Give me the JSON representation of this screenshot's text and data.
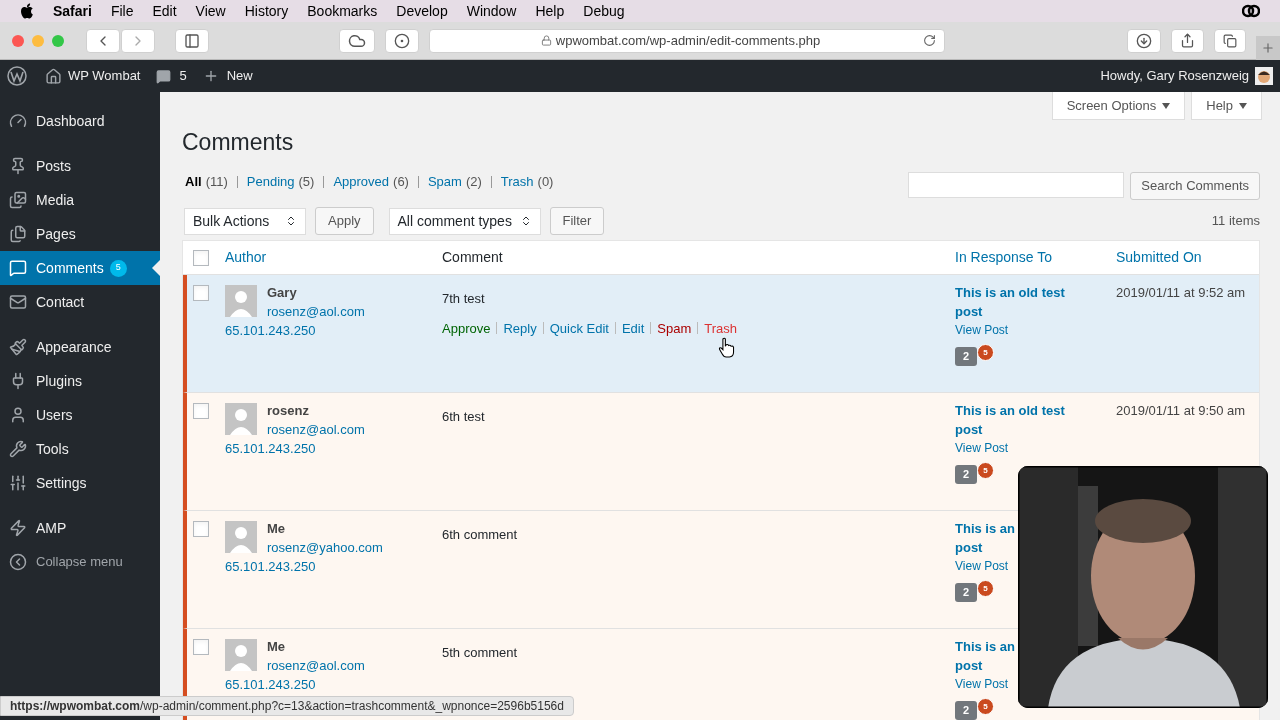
{
  "menubar": {
    "app": "Safari",
    "items": [
      "File",
      "Edit",
      "View",
      "History",
      "Bookmarks",
      "Develop",
      "Window",
      "Help",
      "Debug"
    ]
  },
  "browser": {
    "url": "wpwombat.com/wp-admin/edit-comments.php"
  },
  "adminbar": {
    "site": "WP Wombat",
    "comments": "5",
    "new": "New",
    "howdy": "Howdy, Gary Rosenzweig"
  },
  "sidebar": {
    "items": [
      {
        "label": "Dashboard",
        "selected": false
      },
      {
        "label": "Posts",
        "selected": false
      },
      {
        "label": "Media",
        "selected": false
      },
      {
        "label": "Pages",
        "selected": false
      },
      {
        "label": "Comments",
        "selected": true,
        "badge": "5"
      },
      {
        "label": "Contact",
        "selected": false
      },
      {
        "label": "Appearance",
        "selected": false
      },
      {
        "label": "Plugins",
        "selected": false
      },
      {
        "label": "Users",
        "selected": false
      },
      {
        "label": "Tools",
        "selected": false
      },
      {
        "label": "Settings",
        "selected": false
      },
      {
        "label": "AMP",
        "selected": false
      }
    ],
    "collapse": "Collapse menu"
  },
  "screen_options": "Screen Options",
  "help": "Help",
  "title": "Comments",
  "filters": [
    {
      "label": "All",
      "count": "(11)",
      "selected": true
    },
    {
      "label": "Pending",
      "count": "(5)",
      "selected": false
    },
    {
      "label": "Approved",
      "count": "(6)",
      "selected": false
    },
    {
      "label": "Spam",
      "count": "(2)",
      "selected": false
    },
    {
      "label": "Trash",
      "count": "(0)",
      "selected": false
    }
  ],
  "search_button": "Search Comments",
  "bulk_actions": "Bulk Actions",
  "apply": "Apply",
  "comment_types": "All comment types",
  "filter": "Filter",
  "items_count": "11 items",
  "table": {
    "columns": [
      "Author",
      "Comment",
      "In Response To",
      "Submitted On"
    ],
    "header_checked": false,
    "rows": [
      {
        "checked": false,
        "pending": true,
        "hovered": true,
        "author": "Gary",
        "email": "rosenz@aol.com",
        "ip": "65.101.243.250",
        "comment": "7th test",
        "actions": [
          {
            "label": "Approve",
            "kind": "approve"
          },
          {
            "label": "Reply",
            "kind": "normal"
          },
          {
            "label": "Quick Edit",
            "kind": "normal"
          },
          {
            "label": "Edit",
            "kind": "normal"
          },
          {
            "label": "Spam",
            "kind": "spam"
          },
          {
            "label": "Trash",
            "kind": "trash"
          }
        ],
        "post_title_lines": [
          "This is an old test",
          "post"
        ],
        "view_post": "View Post",
        "approved_count": "2",
        "pending_count": "5",
        "submitted": "2019/01/11 at 9:52 am"
      },
      {
        "checked": false,
        "pending": true,
        "hovered": false,
        "author": "rosenz",
        "email": "rosenz@aol.com",
        "ip": "65.101.243.250",
        "comment": "6th test",
        "post_title_lines": [
          "This is an old test",
          "post"
        ],
        "view_post": "View Post",
        "approved_count": "2",
        "pending_count": "5",
        "submitted": "2019/01/11 at 9:50 am"
      },
      {
        "checked": false,
        "pending": true,
        "hovered": false,
        "author": "Me",
        "email": "rosenz@yahoo.com",
        "ip": "65.101.243.250",
        "comment": "6th comment",
        "post_title_lines": [
          "This is an",
          "post"
        ],
        "view_post": "View Post",
        "approved_count": "2",
        "pending_count": "5"
      },
      {
        "checked": false,
        "pending": true,
        "hovered": false,
        "author": "Me",
        "email": "rosenz@aol.com",
        "ip": "65.101.243.250",
        "comment": "5th comment",
        "post_title_lines": [
          "This is an",
          "post"
        ],
        "view_post": "View Post",
        "approved_count": "2",
        "pending_count": "5"
      }
    ]
  },
  "status_url": "**https://wpwombat.com**/wp-admin/comment.php?c=13&action=trashcomment&_wpnonce=2596b5156d"
}
